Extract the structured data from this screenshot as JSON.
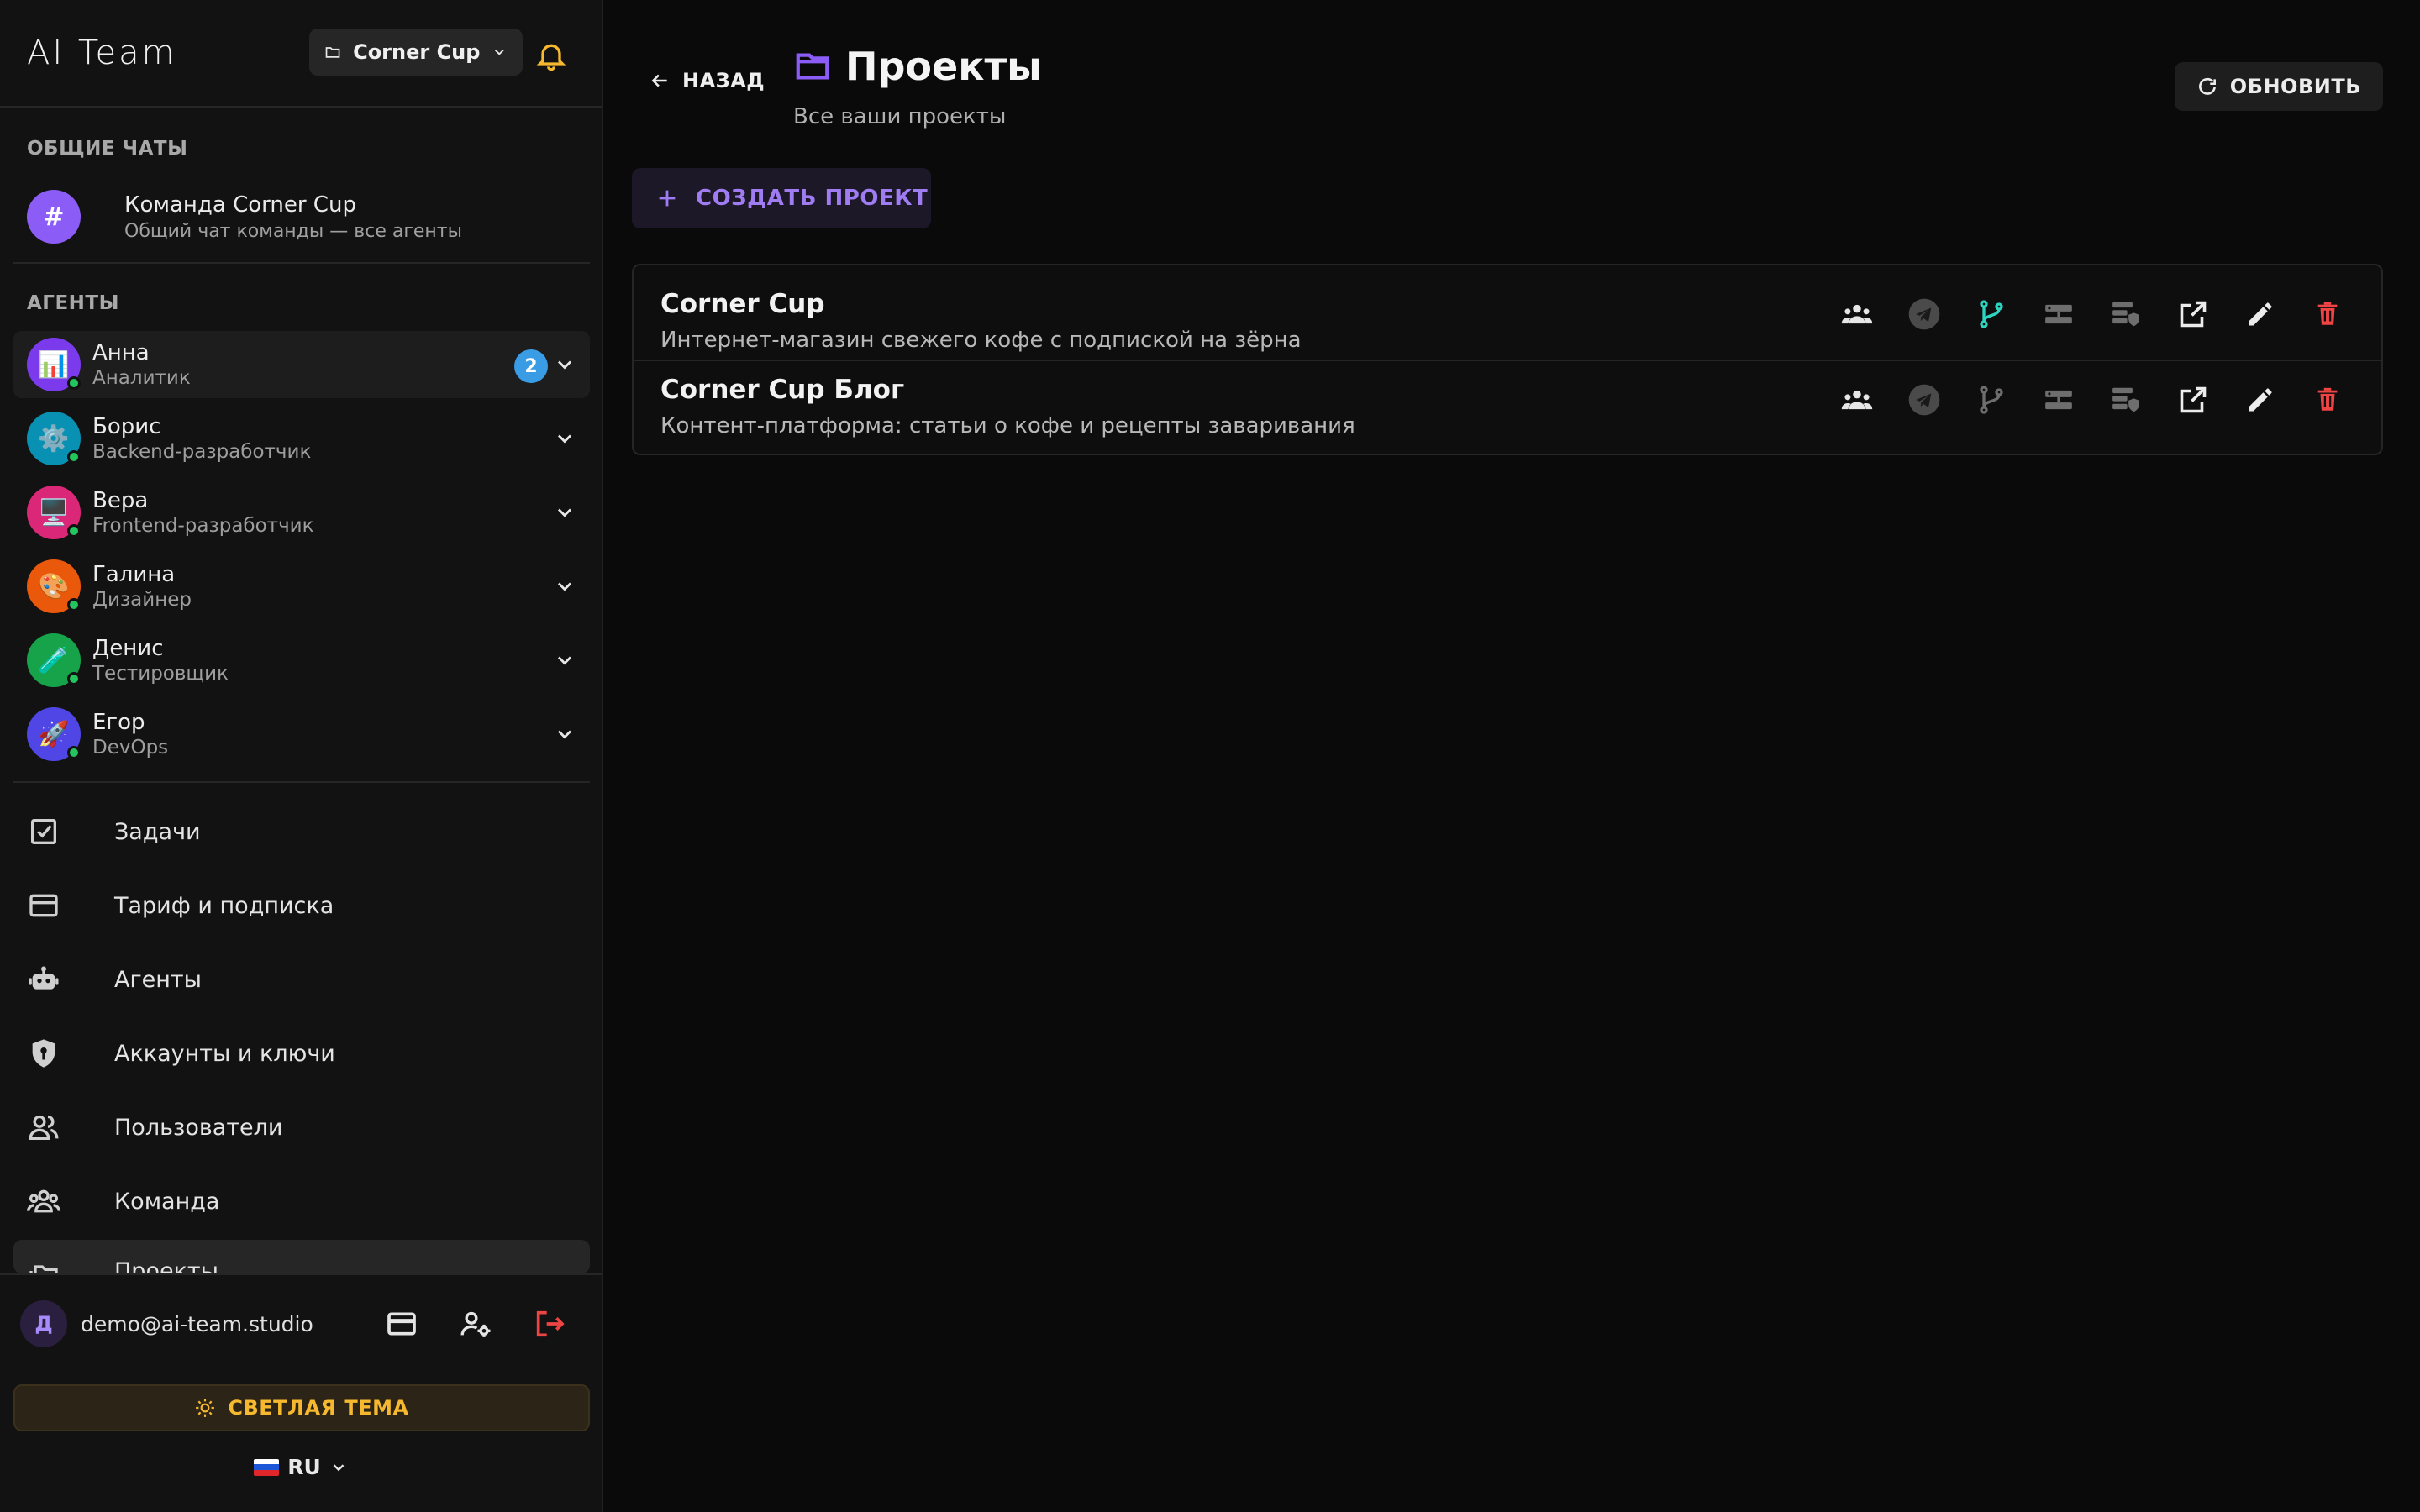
{
  "sidebar": {
    "brand": "AI Team",
    "project_selector": "Corner Cup",
    "common_chats_title": "ОБЩИЕ ЧАТЫ",
    "team_chat": {
      "avatar": "#",
      "title": "Команда Corner Cup",
      "subtitle": "Общий чат команды — все агенты"
    },
    "agents_title": "АГЕНТЫ",
    "agents": [
      {
        "name": "Анна",
        "role": "Аналитик",
        "emoji": "📊",
        "color": "#7c3aed",
        "badge": "2"
      },
      {
        "name": "Борис",
        "role": "Backend-разработчик",
        "emoji": "⚙️",
        "color": "#0891b2"
      },
      {
        "name": "Вера",
        "role": "Frontend-разработчик",
        "emoji": "🖥️",
        "color": "#db2777"
      },
      {
        "name": "Галина",
        "role": "Дизайнер",
        "emoji": "🎨",
        "color": "#ea580c"
      },
      {
        "name": "Денис",
        "role": "Тестировщик",
        "emoji": "🧪",
        "color": "#16a34a"
      },
      {
        "name": "Егор",
        "role": "DevOps",
        "emoji": "🚀",
        "color": "#4f46e5"
      }
    ],
    "nav": [
      {
        "label": "Задачи",
        "icon": "tasks-icon"
      },
      {
        "label": "Тариф и подписка",
        "icon": "credit-card-icon"
      },
      {
        "label": "Агенты",
        "icon": "robot-icon"
      },
      {
        "label": "Аккаунты и ключи",
        "icon": "shield-key-icon"
      },
      {
        "label": "Пользователи",
        "icon": "users-icon"
      },
      {
        "label": "Команда",
        "icon": "team-icon"
      },
      {
        "label": "Проекты",
        "icon": "folders-icon"
      }
    ],
    "user": {
      "initial": "Д",
      "email": "demo@ai-team.studio"
    },
    "theme_button": "СВЕТЛАЯ ТЕМА",
    "language": "RU"
  },
  "main": {
    "back_label": "НАЗАД",
    "title": "Проекты",
    "subtitle": "Все ваши проекты",
    "refresh_label": "ОБНОВИТЬ",
    "create_label": "СОЗДАТЬ ПРОЕКТ",
    "projects": [
      {
        "name": "Corner Cup",
        "description": "Интернет-магазин свежего кофе с подпиской на зёрна",
        "git_connected": true
      },
      {
        "name": "Corner Cup Блог",
        "description": "Контент-платформа: статьи о кофе и рецепты заваривания",
        "git_connected": false
      }
    ]
  },
  "colors": {
    "accent": "#8b5cf6",
    "online": "#22c55e",
    "badge": "#3b9ce6",
    "danger": "#ef4444",
    "git_active": "#2dd4bf",
    "theme_button": "#f5b82e"
  }
}
